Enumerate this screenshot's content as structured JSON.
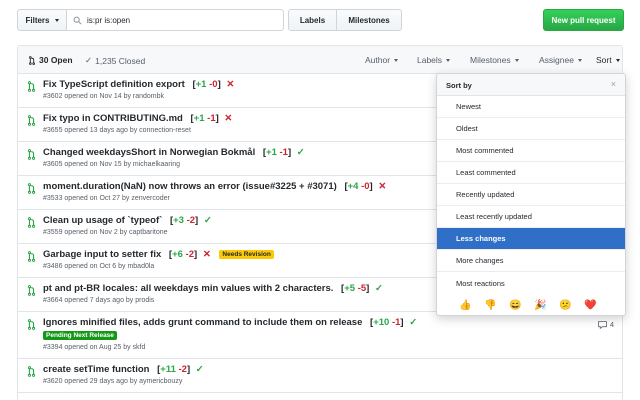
{
  "toolbar": {
    "filters_label": "Filters",
    "search_value": "is:pr is:open",
    "labels_label": "Labels",
    "milestones_label": "Milestones",
    "new_pr_label": "New pull request"
  },
  "list_header": {
    "open_label": "30 Open",
    "closed_label": "1,235 Closed",
    "filters": [
      "Author",
      "Labels",
      "Milestones",
      "Assignee",
      "Sort"
    ]
  },
  "pull_requests": [
    {
      "title": "Fix TypeScript definition export",
      "plus": "+1",
      "minus": "-0",
      "status": "fail",
      "meta": "#3602 opened on Nov 14 by randombk",
      "label": "",
      "comments": ""
    },
    {
      "title": "Fix typo in CONTRIBUTING.md",
      "plus": "+1",
      "minus": "-1",
      "status": "fail",
      "meta": "#3655 opened 13 days ago by connection-reset",
      "label": "",
      "comments": ""
    },
    {
      "title": "Changed weekdaysShort in Norwegian Bokmål",
      "plus": "+1",
      "minus": "-1",
      "status": "ok",
      "meta": "#3605 opened on Nov 15 by michaelkaaring",
      "label": "",
      "comments": ""
    },
    {
      "title": "moment.duration(NaN) now throws an error (issue#3225 + #3071)",
      "plus": "+4",
      "minus": "-0",
      "status": "fail",
      "meta": "#3533 opened on Oct 27 by zenvercoder",
      "label": "",
      "comments": ""
    },
    {
      "title": "Clean up usage of `typeof`",
      "plus": "+3",
      "minus": "-2",
      "status": "ok",
      "meta": "#3559 opened on Nov 2 by captbaritone",
      "label": "",
      "comments": ""
    },
    {
      "title": "Garbage input to setter fix",
      "plus": "+6",
      "minus": "-2",
      "status": "fail",
      "meta": "#3486 opened on Oct 6 by mbad0la",
      "label": "Needs Revision",
      "comments": ""
    },
    {
      "title": "pt and pt-BR locales: all weekdays min values with 2 characters.",
      "plus": "+5",
      "minus": "-5",
      "status": "ok",
      "meta": "#3664 opened 7 days ago by prodis",
      "label": "",
      "comments": ""
    },
    {
      "title": "Ignores minified files, adds grunt command to include them on release",
      "plus": "+10",
      "minus": "-1",
      "status": "ok",
      "meta": "#3394 opened on Aug 25 by skfd",
      "label": "Pending Next Release",
      "comments": "4"
    },
    {
      "title": "create setTime function",
      "plus": "+11",
      "minus": "-2",
      "status": "ok",
      "meta": "#3620 opened 29 days ago by aymericbouzy",
      "label": "",
      "comments": ""
    }
  ],
  "sort_menu": {
    "title": "Sort by",
    "items": [
      "Newest",
      "Oldest",
      "Most commented",
      "Least commented",
      "Recently updated",
      "Least recently updated",
      "Less changes",
      "More changes",
      "Most reactions"
    ],
    "selected": "Less changes",
    "reactions": [
      "thumbs-up",
      "thumbs-down",
      "smile",
      "tada",
      "confused",
      "heart"
    ]
  },
  "colors": {
    "accent": "#2f6fc7",
    "open_green": "#28a745",
    "fail_red": "#cb2431",
    "needs_revision": "#fbca04",
    "pending_release": "#159818"
  }
}
